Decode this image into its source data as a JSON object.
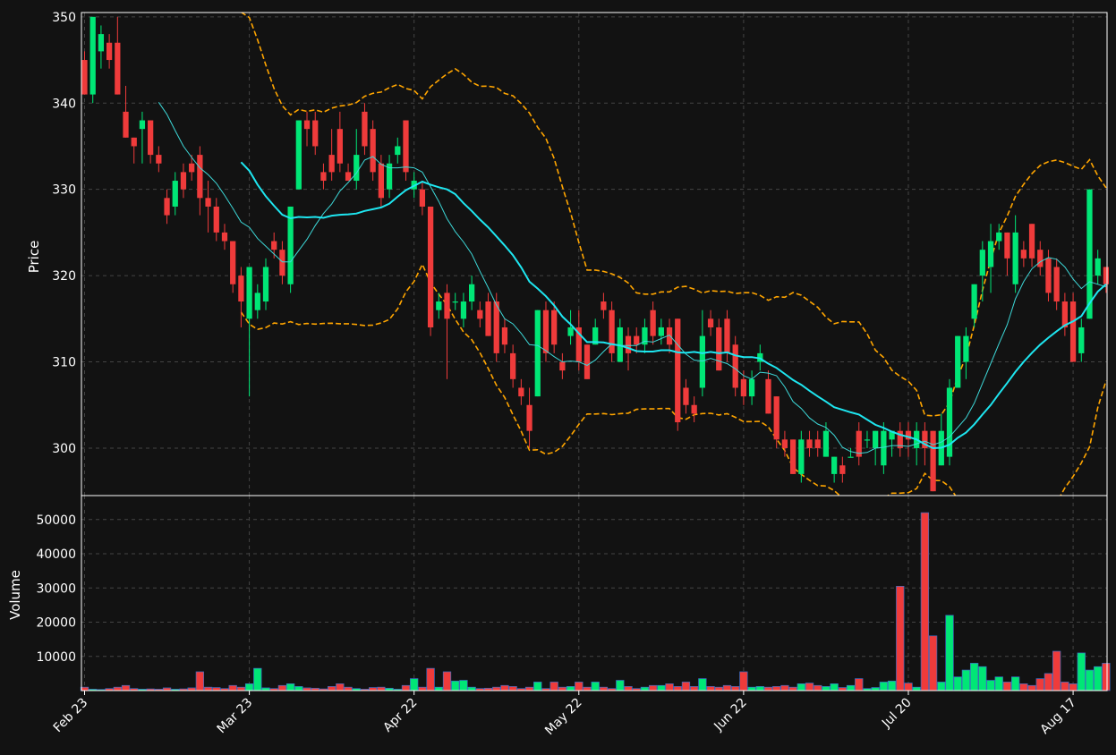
{
  "chart_data": {
    "type": "candlestick",
    "date_ticks": [
      "Feb 23",
      "Mar 23",
      "Apr 22",
      "May 22",
      "Jun 22",
      "Jul 20",
      "Aug 17"
    ],
    "price_panel": {
      "ylabel": "Price",
      "ylim": [
        294.5,
        350.5
      ],
      "yticks": [
        300,
        310,
        320,
        330,
        340,
        350
      ]
    },
    "volume_panel": {
      "ylabel": "Volume",
      "ylim": [
        0,
        57000
      ],
      "yticks": [
        10000,
        20000,
        30000,
        40000,
        50000
      ]
    },
    "candles": [
      [
        345,
        341,
        346,
        341,
        1000
      ],
      [
        341,
        350,
        350,
        340,
        400
      ],
      [
        346,
        348,
        349,
        344,
        300
      ],
      [
        347,
        345,
        348,
        344,
        600
      ],
      [
        347,
        341,
        350,
        341,
        1000
      ],
      [
        339,
        336,
        342,
        336,
        1500
      ],
      [
        336,
        335,
        336,
        333,
        600
      ],
      [
        337,
        338,
        339,
        333,
        400
      ],
      [
        338,
        334,
        338,
        333,
        500
      ],
      [
        334,
        333,
        335,
        332,
        400
      ],
      [
        329,
        327,
        330,
        326,
        800
      ],
      [
        328,
        331,
        332,
        327,
        400
      ],
      [
        332,
        330,
        333,
        329,
        500
      ],
      [
        333,
        332,
        334,
        331,
        800
      ],
      [
        334,
        329,
        335,
        327,
        5500
      ],
      [
        329,
        328,
        331,
        325,
        1000
      ],
      [
        328,
        325,
        329,
        324,
        900
      ],
      [
        325,
        324,
        326,
        323,
        600
      ],
      [
        324,
        319,
        324,
        318,
        1500
      ],
      [
        320,
        317,
        321,
        314,
        1000
      ],
      [
        315,
        321,
        321,
        306,
        2000
      ],
      [
        316,
        318,
        319,
        315,
        6500
      ],
      [
        317,
        321,
        322,
        316,
        800
      ],
      [
        324,
        323,
        325,
        322,
        600
      ],
      [
        323,
        320,
        324,
        319,
        1500
      ],
      [
        319,
        328,
        328,
        318,
        2000
      ],
      [
        330,
        338,
        338,
        330,
        1200
      ],
      [
        338,
        337,
        339,
        335,
        800
      ],
      [
        338,
        335,
        339,
        334,
        700
      ],
      [
        332,
        331,
        333,
        330,
        500
      ],
      [
        334,
        332,
        337,
        331,
        1200
      ],
      [
        337,
        333,
        339,
        332,
        2000
      ],
      [
        332,
        331,
        333,
        331,
        1000
      ],
      [
        331,
        334,
        337,
        330,
        600
      ],
      [
        339,
        335,
        340,
        334,
        400
      ],
      [
        337,
        332,
        338,
        331,
        900
      ],
      [
        333,
        329,
        334,
        328,
        1000
      ],
      [
        330,
        333,
        334,
        329,
        700
      ],
      [
        334,
        335,
        336,
        333,
        400
      ],
      [
        338,
        332,
        338,
        331,
        1500
      ],
      [
        330,
        331,
        332,
        329,
        3500
      ],
      [
        330,
        328,
        331,
        327,
        1000
      ],
      [
        328,
        314,
        328,
        313,
        6500
      ],
      [
        316,
        317,
        318,
        315,
        1000
      ],
      [
        318,
        315,
        319,
        308,
        5500
      ],
      [
        317,
        317,
        318,
        316,
        2800
      ],
      [
        315,
        317,
        318,
        314,
        3000
      ],
      [
        317,
        319,
        320,
        316,
        1000
      ],
      [
        316,
        315,
        317,
        314,
        600
      ],
      [
        317,
        313,
        318,
        313,
        700
      ],
      [
        317,
        311,
        318,
        310,
        1000
      ],
      [
        314,
        312,
        315,
        311,
        1500
      ],
      [
        311,
        308,
        312,
        307,
        1200
      ],
      [
        307,
        306,
        308,
        305,
        600
      ],
      [
        305,
        302,
        307,
        300,
        1000
      ],
      [
        306,
        316,
        316,
        306,
        2500
      ],
      [
        316,
        311,
        317,
        310,
        600
      ],
      [
        316,
        312,
        317,
        311,
        2500
      ],
      [
        310,
        309,
        311,
        308,
        1000
      ],
      [
        313,
        314,
        316,
        312,
        1200
      ],
      [
        314,
        310,
        316,
        309,
        2500
      ],
      [
        312,
        308,
        312,
        308,
        1000
      ],
      [
        312,
        314,
        315,
        312,
        2500
      ],
      [
        317,
        316,
        318,
        315,
        1000
      ],
      [
        316,
        311,
        317,
        310,
        600
      ],
      [
        310,
        314,
        315,
        310,
        3000
      ],
      [
        313,
        311,
        314,
        309,
        1200
      ],
      [
        313,
        312,
        314,
        311,
        600
      ],
      [
        312,
        314,
        315,
        311,
        1000
      ],
      [
        316,
        313,
        317,
        312,
        1500
      ],
      [
        313,
        314,
        315,
        312,
        1500
      ],
      [
        314,
        312,
        315,
        311,
        2000
      ],
      [
        315,
        303,
        315,
        302,
        1200
      ],
      [
        307,
        305,
        308,
        304,
        2500
      ],
      [
        305,
        304,
        306,
        303,
        1200
      ],
      [
        307,
        313,
        316,
        306,
        3500
      ],
      [
        315,
        314,
        316,
        313,
        1200
      ],
      [
        314,
        309,
        315,
        309,
        1000
      ],
      [
        315,
        311,
        316,
        310,
        1500
      ],
      [
        312,
        307,
        313,
        306,
        1200
      ],
      [
        308,
        306,
        309,
        305,
        5500
      ],
      [
        306,
        308,
        309,
        305,
        1000
      ],
      [
        310,
        311,
        312,
        309,
        1200
      ],
      [
        308,
        304,
        309,
        304,
        1000
      ],
      [
        306,
        301,
        306,
        300,
        1200
      ],
      [
        301,
        300,
        302,
        299,
        1500
      ],
      [
        301,
        297,
        301,
        297,
        1000
      ],
      [
        297,
        301,
        302,
        296,
        2000
      ],
      [
        301,
        300,
        302,
        299,
        2200
      ],
      [
        301,
        300,
        302,
        299,
        1500
      ],
      [
        299,
        302,
        303,
        299,
        1200
      ],
      [
        297,
        299,
        299,
        296,
        2000
      ],
      [
        298,
        297,
        299,
        296,
        900
      ],
      [
        299,
        299,
        300,
        299,
        1500
      ],
      [
        302,
        299,
        303,
        298,
        3500
      ],
      [
        301,
        301,
        302,
        300,
        600
      ],
      [
        300,
        302,
        302,
        298,
        900
      ],
      [
        298,
        302,
        303,
        297,
        2500
      ],
      [
        301,
        302,
        302,
        299,
        2800
      ],
      [
        302,
        300,
        303,
        299,
        30500
      ],
      [
        302,
        301,
        303,
        299,
        2200
      ],
      [
        300,
        302,
        303,
        298,
        1000
      ],
      [
        302,
        300,
        303,
        298,
        52000
      ],
      [
        302,
        295,
        302,
        295,
        16000
      ],
      [
        298,
        302,
        304,
        298,
        2500
      ],
      [
        299,
        307,
        308,
        298,
        22000
      ],
      [
        307,
        313,
        313,
        307,
        4000
      ],
      [
        310,
        313,
        314,
        308,
        6000
      ],
      [
        315,
        319,
        319,
        314,
        8000
      ],
      [
        320,
        323,
        324,
        317,
        7000
      ],
      [
        321,
        324,
        326,
        318,
        3000
      ],
      [
        324,
        325,
        326,
        323,
        4000
      ],
      [
        325,
        322,
        325,
        320,
        2500
      ],
      [
        319,
        325,
        327,
        318,
        4000
      ],
      [
        323,
        322,
        324,
        321,
        2000
      ],
      [
        326,
        322,
        326,
        321,
        1500
      ],
      [
        323,
        321,
        324,
        320,
        3500
      ],
      [
        322,
        318,
        323,
        317,
        5000
      ],
      [
        321,
        317,
        322,
        316,
        11500
      ],
      [
        317,
        314,
        318,
        313,
        2500
      ],
      [
        317,
        310,
        318,
        310,
        2000
      ],
      [
        311,
        314,
        315,
        310,
        11000
      ],
      [
        315,
        330,
        330,
        315,
        6000
      ],
      [
        320,
        322,
        323,
        319,
        7000
      ],
      [
        321,
        319,
        321,
        318,
        8000
      ]
    ]
  }
}
